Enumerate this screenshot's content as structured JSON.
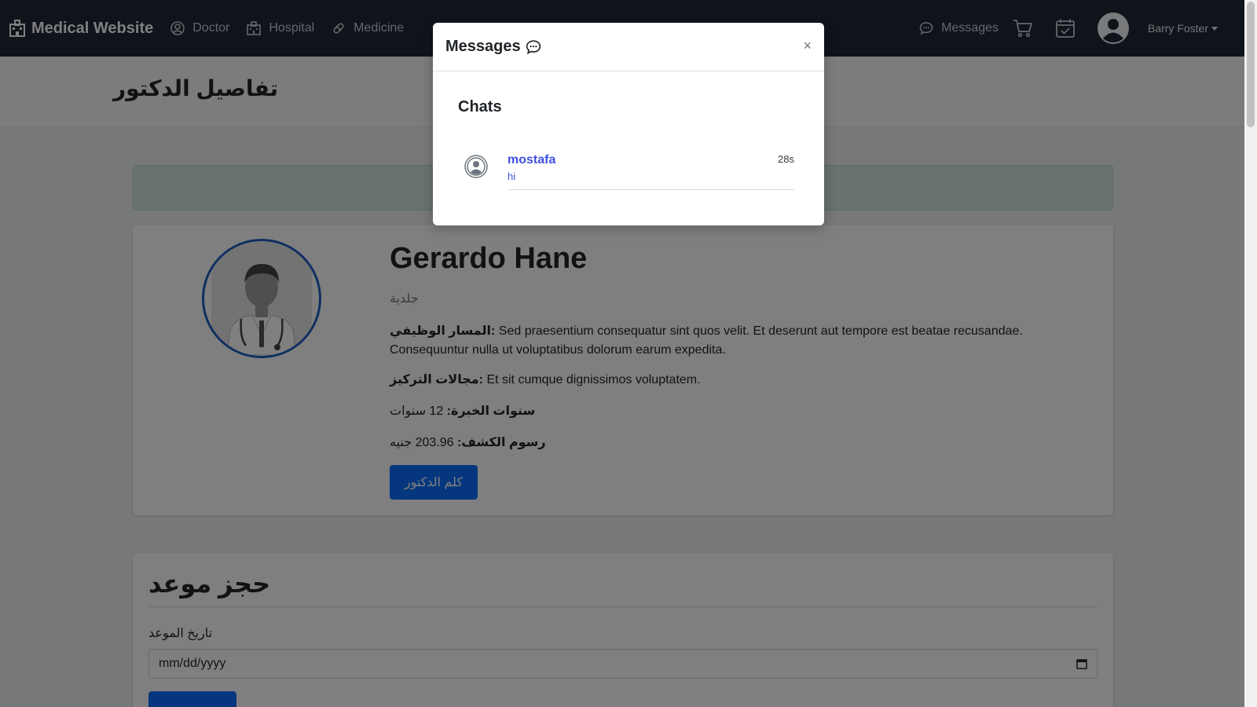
{
  "navbar": {
    "brand": "Medical Website",
    "links": [
      "Doctor",
      "Hospital",
      "Medicine"
    ],
    "messages_label": "Messages",
    "user_name": "Barry Foster"
  },
  "header": {
    "title": "تفاصيل الدكتور"
  },
  "doctor": {
    "name": "Gerardo Hane",
    "specialty": "جلدية",
    "career_label": "المسار الوظيفي:",
    "career_text": "Sed praesentium consequatur sint quos velit. Et deserunt aut tempore est beatae recusandae. Consequuntur nulla ut voluptatibus dolorum earum expedita.",
    "focus_label": "مجالات التركيز:",
    "focus_text": "Et sit cumque dignissimos voluptatem.",
    "experience_label": "سنوات الخبرة:",
    "experience_text": "12 سنوات",
    "fees_label": "رسوم الكشف:",
    "fees_text": "203.96 جنيه",
    "contact_button": "كلم الدكتور"
  },
  "booking": {
    "title": "حجز موعد",
    "date_label": "تاريخ الموعد",
    "date_placeholder": "mm/dd/yyyy"
  },
  "modal": {
    "title": "Messages",
    "close": "×",
    "chats_heading": "Chats",
    "chats": [
      {
        "name": "mostafa",
        "message": "hi",
        "time": "28s"
      }
    ]
  },
  "colors": {
    "navbar": "#1f2937",
    "primary": "#0d6efd",
    "chat_link": "#3f51e0",
    "alert_success": "#d1e7dd"
  }
}
